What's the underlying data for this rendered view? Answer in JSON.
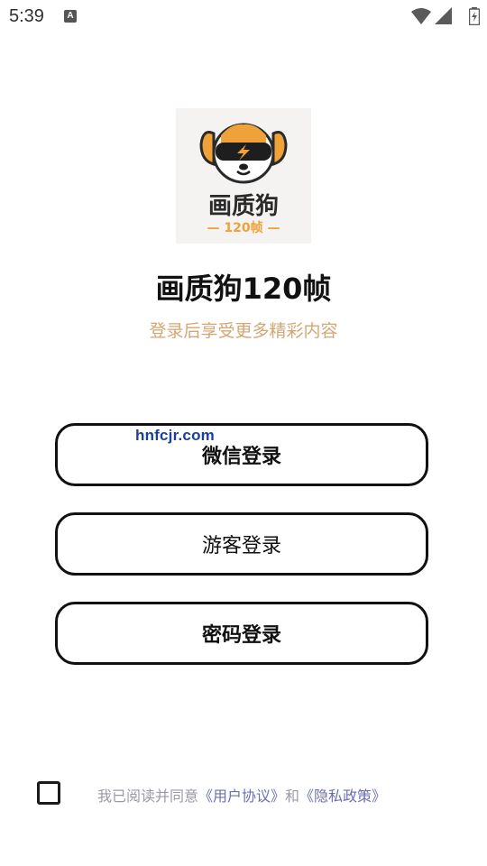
{
  "status_bar": {
    "time": "5:39",
    "notification_icon": "A",
    "icons": [
      "wifi-icon",
      "signal-icon",
      "battery-icon"
    ]
  },
  "logo": {
    "name_text": "画质狗",
    "sub_text": "— 120帧 —"
  },
  "app": {
    "title": "画质狗120帧",
    "subtitle": "登录后享受更多精彩内容"
  },
  "buttons": {
    "wechat": "微信登录",
    "guest": "游客登录",
    "password": "密码登录"
  },
  "watermark": "hnfcjr.com",
  "agreement": {
    "prefix": "我已阅读并同意",
    "user_agreement": "《用户协议》",
    "conjunction": "和",
    "privacy_policy": "《隐私政策》",
    "checked": false
  },
  "colors": {
    "subtitle": "#d4a673",
    "link": "#6a6fb3",
    "logo_accent": "#f0a23a"
  }
}
